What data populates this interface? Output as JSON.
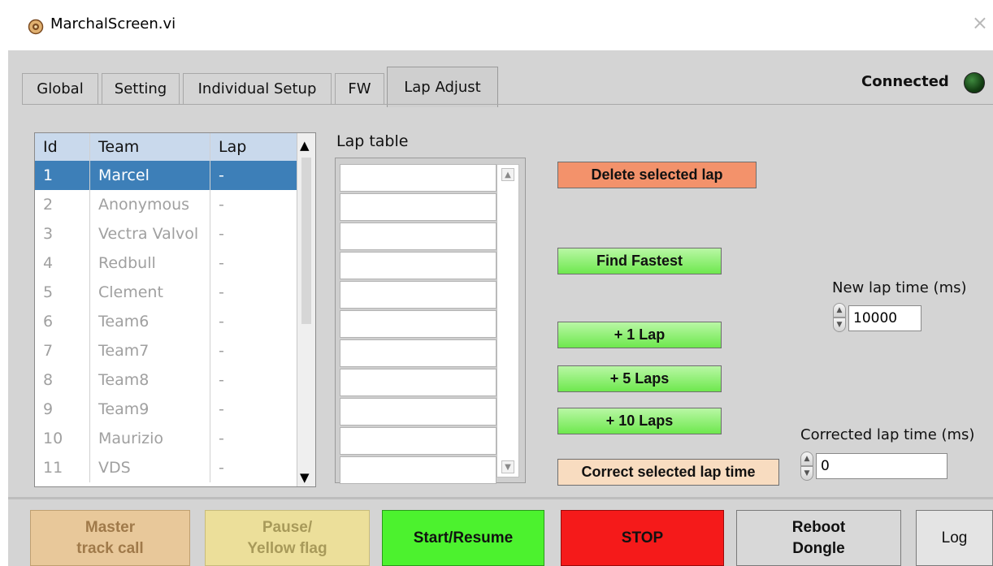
{
  "window": {
    "title": "MarchalScreen.vi",
    "close_glyph": "×"
  },
  "tabs": [
    {
      "label": "Global"
    },
    {
      "label": "Setting"
    },
    {
      "label": "Individual Setup"
    },
    {
      "label": "FW"
    },
    {
      "label": "Lap Adjust",
      "active": true
    }
  ],
  "status": {
    "label": "Connected",
    "led_color": "#1d5a1d"
  },
  "team_table": {
    "headers": {
      "id": "Id",
      "team": "Team",
      "lap": "Lap"
    },
    "selected_row": 1,
    "rows": [
      {
        "id": "1",
        "team": "Marcel",
        "lap": "-"
      },
      {
        "id": "2",
        "team": "Anonymous",
        "lap": "-"
      },
      {
        "id": "3",
        "team": "Vectra Valvol",
        "lap": "-"
      },
      {
        "id": "4",
        "team": "Redbull",
        "lap": "-"
      },
      {
        "id": "5",
        "team": "Clement",
        "lap": "-"
      },
      {
        "id": "6",
        "team": "Team6",
        "lap": "-"
      },
      {
        "id": "7",
        "team": "Team7",
        "lap": "-"
      },
      {
        "id": "8",
        "team": "Team8",
        "lap": "-"
      },
      {
        "id": "9",
        "team": "Team9",
        "lap": "-"
      },
      {
        "id": "10",
        "team": "Maurizio",
        "lap": "-"
      },
      {
        "id": "11",
        "team": "VDS",
        "lap": "-"
      }
    ]
  },
  "lap_table": {
    "title": "Lap table"
  },
  "buttons": {
    "delete_lap": "Delete selected lap",
    "find_fastest": "Find Fastest",
    "plus_1": "+ 1 Lap",
    "plus_5": "+ 5  Laps",
    "plus_10": "+ 10 Laps",
    "correct_lap_time": "Correct selected lap time"
  },
  "new_lap_time": {
    "label": "New lap time (ms)",
    "value": "10000"
  },
  "corrected_lap_time": {
    "label": "Corrected lap time (ms)",
    "value": "0"
  },
  "bottom_buttons": {
    "master_track_call": [
      "Master",
      "track call"
    ],
    "pause_yellow_flag": [
      "Pause/",
      "Yellow flag"
    ],
    "start_resume": "Start/Resume",
    "stop": "STOP",
    "reboot_dongle": [
      "Reboot",
      "Dongle"
    ],
    "log": "Log"
  },
  "colors": {
    "panel": "#d4d4d4",
    "selected_row": "#3d7fb8",
    "delete_button": "#f3926b",
    "green_button": "#7df25a",
    "correct_button": "#f8dcc0",
    "master_track_call": "#e8c89a",
    "pause_yellow": "#ecdf9a",
    "start_resume": "#4cf22e",
    "stop": "#f51a1a",
    "reboot": "#d8d8d8"
  }
}
